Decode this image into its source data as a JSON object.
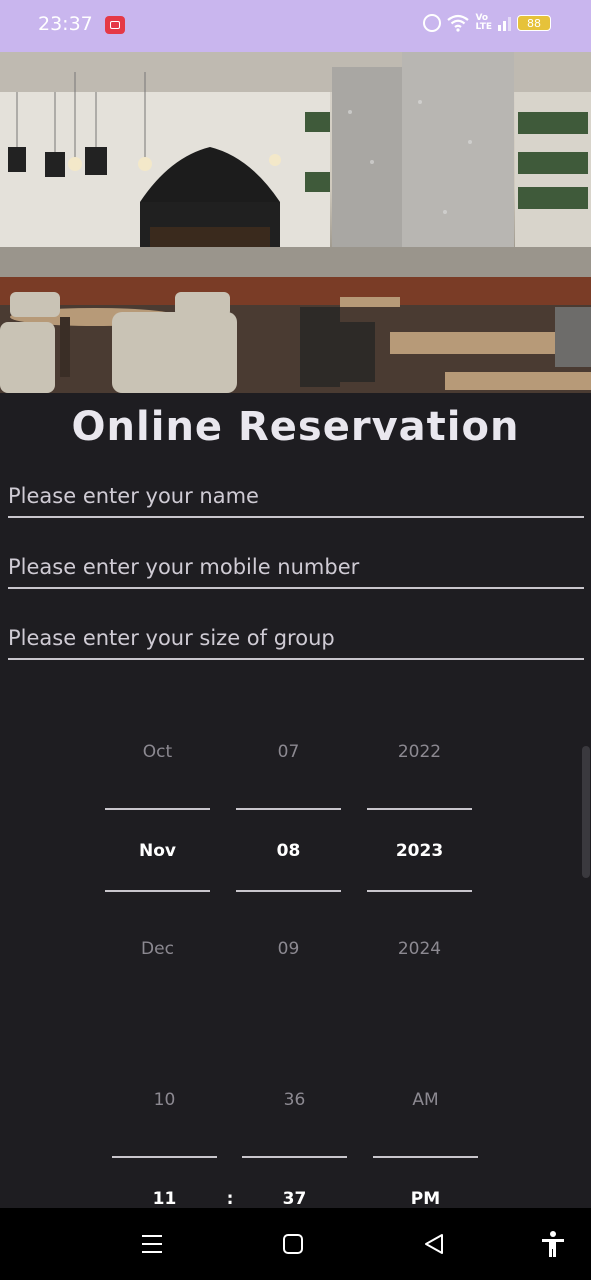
{
  "status_bar": {
    "time": "23:37",
    "battery": "88"
  },
  "form": {
    "title": "Online Reservation",
    "name_placeholder": "Please enter your name",
    "mobile_placeholder": "Please enter your mobile number",
    "group_placeholder": "Please enter your size of group"
  },
  "date_picker": {
    "month": {
      "prev": "Oct",
      "current": "Nov",
      "next": "Dec"
    },
    "day": {
      "prev": "07",
      "current": "08",
      "next": "09"
    },
    "year": {
      "prev": "2022",
      "current": "2023",
      "next": "2024"
    }
  },
  "time_picker": {
    "hour": {
      "prev": "10",
      "current": "11"
    },
    "minute": {
      "prev": "36",
      "current": "37"
    },
    "ampm": {
      "prev": "AM",
      "current": "PM"
    },
    "separator": ":"
  }
}
